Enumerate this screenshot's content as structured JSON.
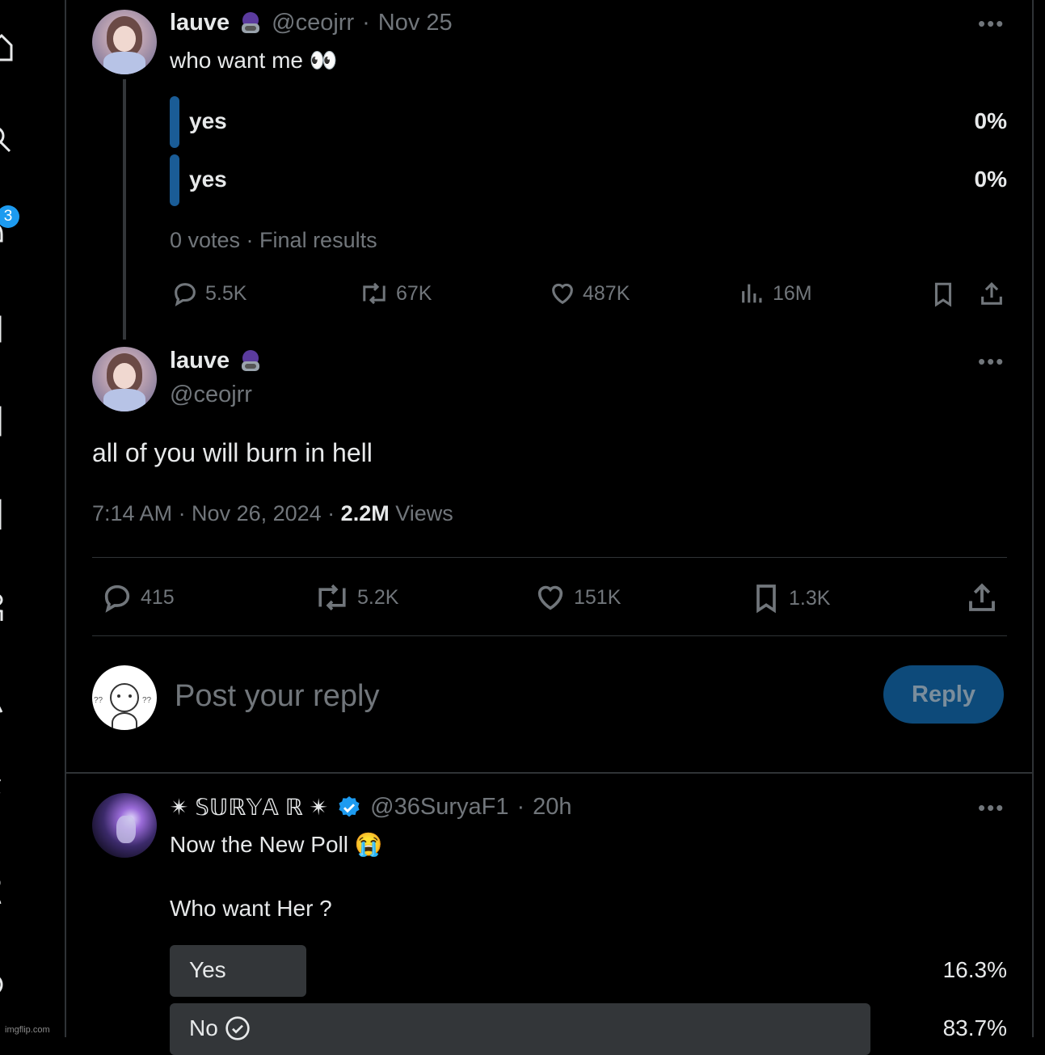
{
  "nav": {
    "notifications_badge": "3"
  },
  "tweet1": {
    "name": "lauve",
    "handle": "@ceojrr",
    "sep": "·",
    "date": "Nov 25",
    "text": "who want me 👀",
    "poll": [
      {
        "label": "yes",
        "percent": "0%",
        "fraction": 0
      },
      {
        "label": "yes",
        "percent": "0%",
        "fraction": 0
      }
    ],
    "poll_meta": "0 votes · Final results",
    "actions": {
      "replies": "5.5K",
      "reposts": "67K",
      "likes": "487K",
      "views": "16M"
    }
  },
  "tweet2": {
    "name": "lauve",
    "handle": "@ceojrr",
    "text": "all of you will burn in hell",
    "time": "7:14 AM · Nov 26, 2024 · ",
    "views_count": "2.2M",
    "views_label": " Views",
    "actions": {
      "replies": "415",
      "reposts": "5.2K",
      "likes": "151K",
      "bookmarks": "1.3K"
    }
  },
  "composer": {
    "placeholder": "Post your reply",
    "button": "Reply"
  },
  "reply": {
    "name": "✴ 𝕊𝕌ℝ𝕐𝔸 ℝ ✴",
    "handle": "@36SuryaF1",
    "sep": "·",
    "time": "20h",
    "line1": "Now the New Poll 😭",
    "line2": "Who want Her ?",
    "poll": [
      {
        "label": "Yes",
        "percent": "16.3%",
        "fraction": 0.163
      },
      {
        "label": "No",
        "percent": "83.7%",
        "fraction": 0.837
      }
    ]
  },
  "watermark": "imgflip.com",
  "colors": {
    "accent": "#1d9bf0",
    "poll_bar_blue": "#1a5c96",
    "reply_button": "#0d4a7a",
    "poll_grey": "#333639"
  }
}
